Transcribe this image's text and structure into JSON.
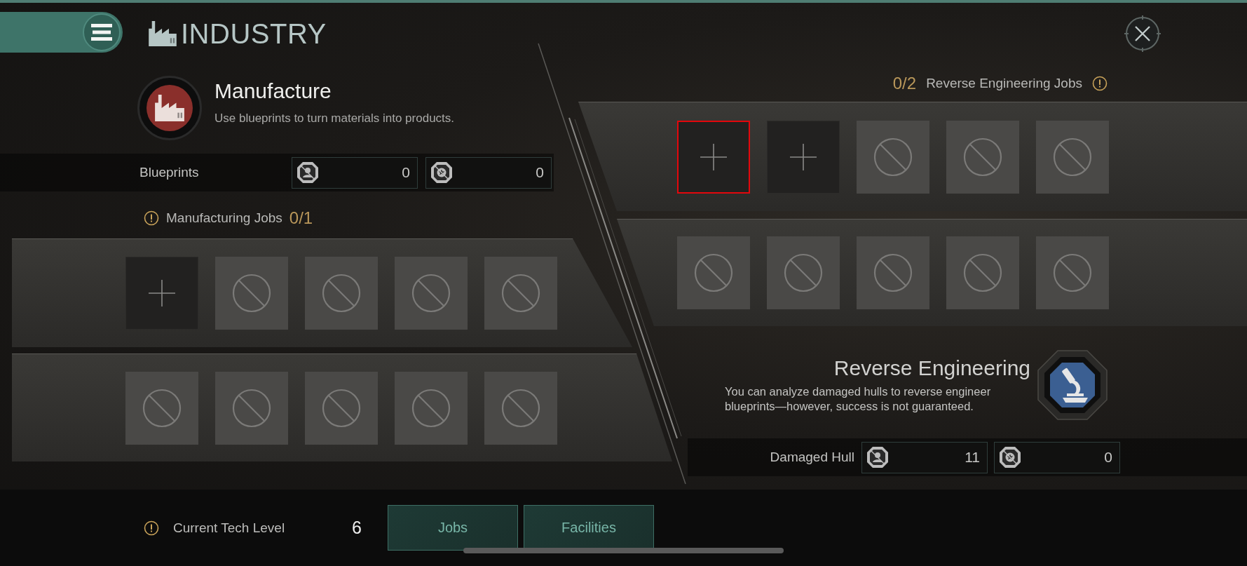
{
  "header": {
    "title": "INDUSTRY"
  },
  "manufacture": {
    "title": "Manufacture",
    "description": "Use blueprints to turn materials into products.",
    "blueprints": {
      "label": "Blueprints",
      "counts": [
        "0",
        "0"
      ]
    },
    "jobs": {
      "label": "Manufacturing Jobs",
      "count": "0/1"
    },
    "rows": [
      {
        "slots": [
          {
            "kind": "add",
            "highlighted": false
          },
          {
            "kind": "locked",
            "highlighted": false
          },
          {
            "kind": "locked",
            "highlighted": false
          },
          {
            "kind": "locked",
            "highlighted": false
          },
          {
            "kind": "locked",
            "highlighted": false
          }
        ]
      },
      {
        "slots": [
          {
            "kind": "locked",
            "highlighted": false
          },
          {
            "kind": "locked",
            "highlighted": false
          },
          {
            "kind": "locked",
            "highlighted": false
          },
          {
            "kind": "locked",
            "highlighted": false
          },
          {
            "kind": "locked",
            "highlighted": false
          }
        ]
      }
    ]
  },
  "reverse_engineering": {
    "jobs": {
      "count": "0/2",
      "label": "Reverse Engineering Jobs"
    },
    "rows": [
      {
        "slots": [
          {
            "kind": "add",
            "highlighted": true
          },
          {
            "kind": "add",
            "highlighted": false
          },
          {
            "kind": "locked",
            "highlighted": false
          },
          {
            "kind": "locked",
            "highlighted": false
          },
          {
            "kind": "locked",
            "highlighted": false
          }
        ]
      },
      {
        "slots": [
          {
            "kind": "locked",
            "highlighted": false
          },
          {
            "kind": "locked",
            "highlighted": false
          },
          {
            "kind": "locked",
            "highlighted": false
          },
          {
            "kind": "locked",
            "highlighted": false
          },
          {
            "kind": "locked",
            "highlighted": false
          }
        ]
      }
    ],
    "title": "Reverse Engineering",
    "description": "You can analyze damaged hulls to reverse engineer blueprints—however, success is not guaranteed.",
    "damaged_hull": {
      "label": "Damaged Hull",
      "counts": [
        "11",
        "0"
      ]
    }
  },
  "footer": {
    "tech_level_label": "Current Tech Level",
    "tech_level": "6",
    "buttons": [
      {
        "label": "Jobs"
      },
      {
        "label": "Facilities"
      }
    ]
  }
}
